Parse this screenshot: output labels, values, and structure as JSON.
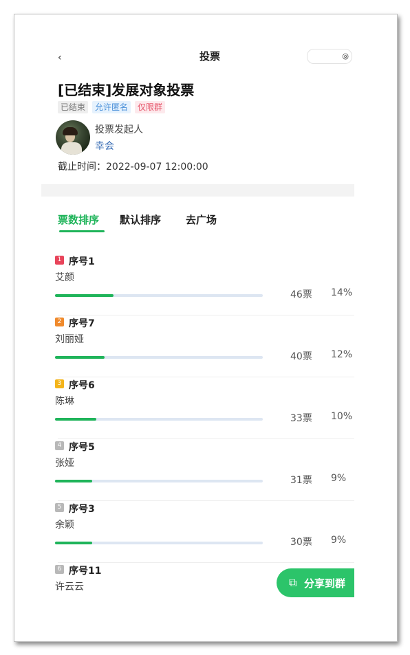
{
  "nav": {
    "title": "投票",
    "back_icon": "chevron-left-icon",
    "capsule_icon": "close-circle-icon"
  },
  "poll": {
    "title": "[已结束]发展对象投票",
    "tags": [
      "已结束",
      "允许匿名",
      "仅限群"
    ],
    "initiator_label": "投票发起人",
    "initiator_name": "幸会",
    "deadline": "截止时间：2022-09-07 12:00:00"
  },
  "tabs": [
    {
      "label": "票数排序",
      "active": true
    },
    {
      "label": "默认排序",
      "active": false
    },
    {
      "label": "去广场",
      "active": false
    }
  ],
  "candidates": [
    {
      "rank": "1",
      "seq": "序号1",
      "name": "艾颜",
      "votes": "46票",
      "percent": "14%",
      "fraction": 0.14,
      "rank_color": "#e8445a"
    },
    {
      "rank": "2",
      "seq": "序号7",
      "name": "刘丽娅",
      "votes": "40票",
      "percent": "12%",
      "fraction": 0.12,
      "rank_color": "#f08a2c"
    },
    {
      "rank": "3",
      "seq": "序号6",
      "name": "陈琳",
      "votes": "33票",
      "percent": "10%",
      "fraction": 0.1,
      "rank_color": "#f4b41a"
    },
    {
      "rank": "4",
      "seq": "序号5",
      "name": "张娅",
      "votes": "31票",
      "percent": "9%",
      "fraction": 0.09,
      "rank_color": "#b8b8b8"
    },
    {
      "rank": "5",
      "seq": "序号3",
      "name": "余颖",
      "votes": "30票",
      "percent": "9%",
      "fraction": 0.09,
      "rank_color": "#b8b8b8"
    },
    {
      "rank": "6",
      "seq": "序号11",
      "name": "许云云",
      "votes": "",
      "percent": "",
      "fraction": 0,
      "rank_color": "#b8b8b8"
    }
  ],
  "share": {
    "label": "分享到群",
    "icon": "share-icon"
  }
}
